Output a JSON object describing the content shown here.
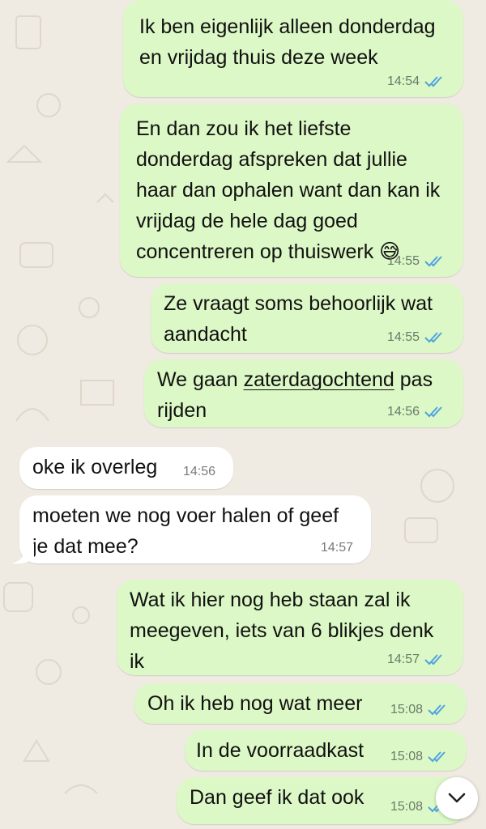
{
  "messages": [
    {
      "dir": "out",
      "text": "Ik ben eigenlijk alleen donderdag\nen vrijdag thuis deze week",
      "time": "14:54",
      "status": "read"
    },
    {
      "dir": "out",
      "text": "En dan zou ik het liefste\ndonderdag afspreken dat jullie\nhaar dan ophalen want dan kan ik\nvrijdag de hele dag goed\nconcentreren op thuiswerk 😅",
      "time": "14:55",
      "status": "read"
    },
    {
      "dir": "out",
      "text": "Ze vraagt soms behoorlijk wat\naandacht",
      "time": "14:55",
      "status": "read"
    },
    {
      "dir": "out",
      "text_before": "We gaan ",
      "text_link": "zaterdagochtend",
      "text_after": " pas\nrijden",
      "time": "14:56",
      "status": "read"
    },
    {
      "dir": "in",
      "text": "oke ik overleg",
      "time": "14:56"
    },
    {
      "dir": "in",
      "text": "moeten we nog voer halen of geef\nje dat mee?",
      "time": "14:57"
    },
    {
      "dir": "out",
      "text": "Wat ik hier nog heb staan zal ik\nmeegeven, iets van 6 blikjes denk\nik",
      "time": "14:57",
      "status": "read"
    },
    {
      "dir": "out",
      "text": "Oh ik heb nog wat meer",
      "time": "15:08",
      "status": "read"
    },
    {
      "dir": "out",
      "text": "In de voorraadkast",
      "time": "15:08",
      "status": "read"
    },
    {
      "dir": "out",
      "text": "Dan geef ik dat ook",
      "time": "15:08",
      "status": "read"
    }
  ],
  "colors": {
    "outgoing_bubble": "#dcf8c6",
    "incoming_bubble": "#ffffff",
    "background": "#efeae2",
    "read_ticks": "#4fa3e0"
  },
  "icons": {
    "read_receipt": "double-check-icon",
    "scroll_button": "chevron-down-icon"
  }
}
